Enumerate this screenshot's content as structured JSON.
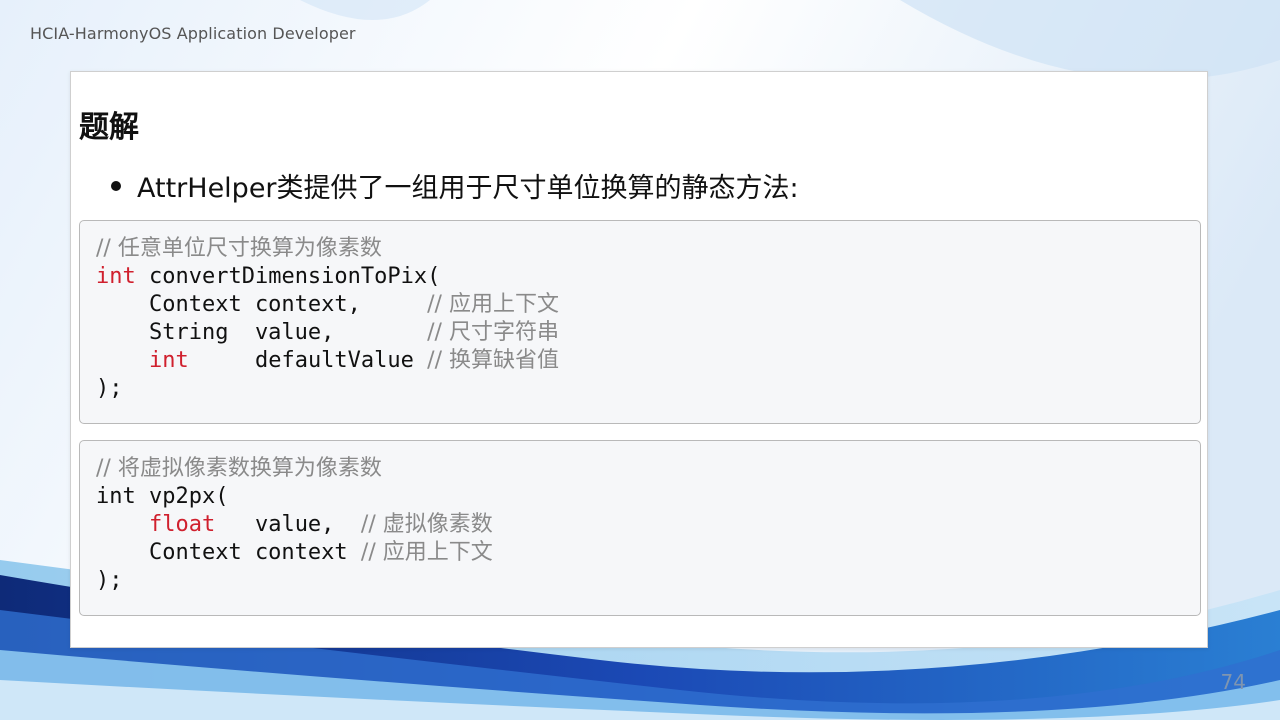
{
  "header": {
    "course_label": "HCIA-HarmonyOS Application Developer"
  },
  "slide": {
    "title": "题解",
    "bullet": "AttrHelper类提供了一组用于尺寸单位换算的静态方法:",
    "code_block_1": {
      "comment": "// 任意单位尺寸换算为像素数",
      "line2_type": "int",
      "line2_rest": " convertDimensionToPix(",
      "line3_code": "    Context context,     ",
      "line3_comment": "// 应用上下文",
      "line4_code": "    String  value,       ",
      "line4_comment": "// 尺寸字符串",
      "line5_indent": "    ",
      "line5_type": "int",
      "line5_code": "     defaultValue ",
      "line5_comment": "// 换算缺省值",
      "line6": ");"
    },
    "code_block_2": {
      "comment": "// 将虚拟像素数换算为像素数",
      "line2": "int vp2px(",
      "line3_indent": "    ",
      "line3_type": "float",
      "line3_code": "   value,  ",
      "line3_comment": "// 虚拟像素数",
      "line4_code": "    Context context ",
      "line4_comment": "// 应用上下文",
      "line5": ");"
    }
  },
  "footer": {
    "page_number": "74"
  },
  "colors": {
    "keyword": "#d0202e",
    "comment": "#8a8a8a",
    "wave_dark": "#1e3a8a",
    "wave_light": "#6fb6e6"
  }
}
